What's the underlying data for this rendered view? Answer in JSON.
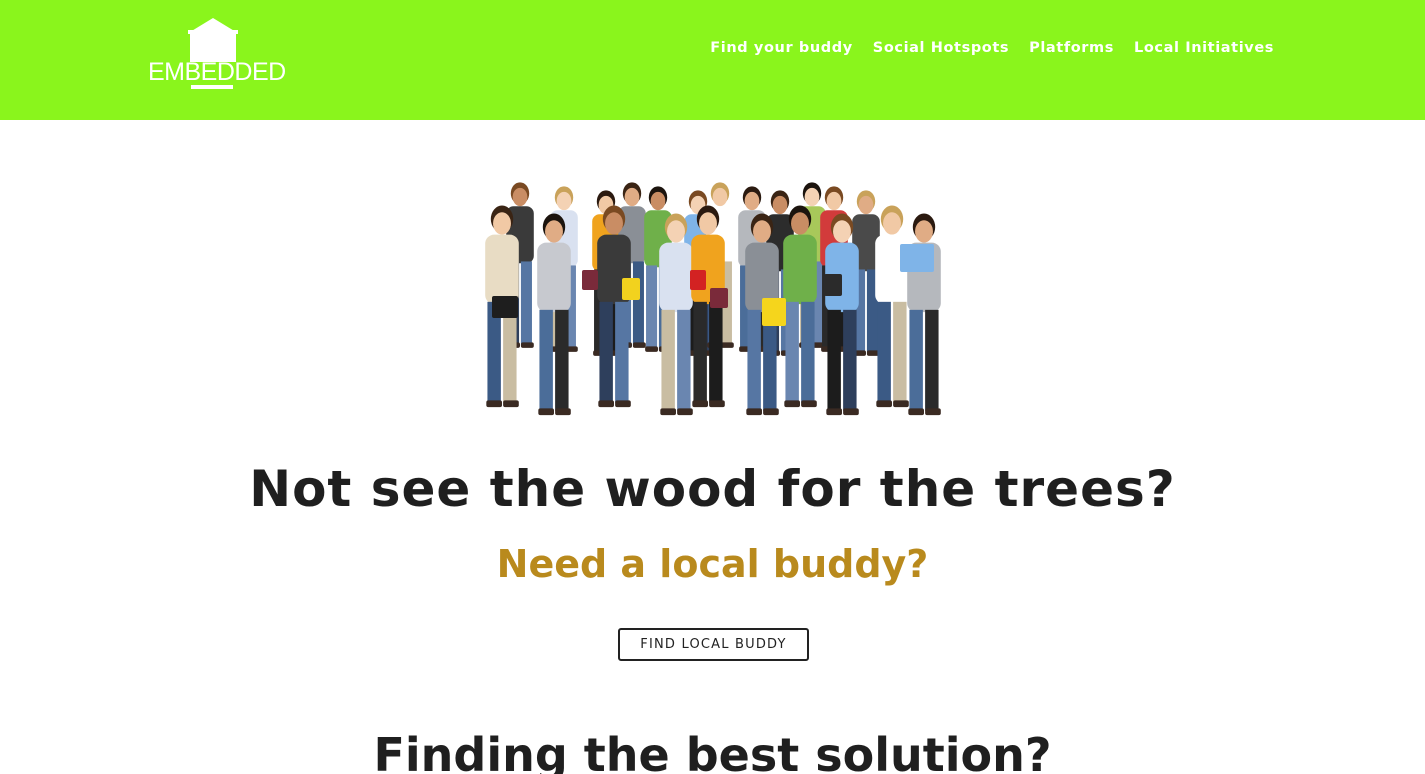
{
  "brand": {
    "logo_text": "EMBEDDED",
    "color": "#8af51c"
  },
  "nav": {
    "items": [
      {
        "label": "Find your buddy"
      },
      {
        "label": "Social Hotspots"
      },
      {
        "label": "Platforms"
      },
      {
        "label": "Local Initiatives"
      }
    ]
  },
  "hero": {
    "image_icon": "group-of-students-photo",
    "headline": "Not see the wood for the trees?",
    "subheadline": "Need a local buddy?",
    "cta_label": "FIND LOCAL BUDDY",
    "accent_color": "#b98a1d"
  },
  "next_section": {
    "headline": "Finding the best solution?"
  }
}
